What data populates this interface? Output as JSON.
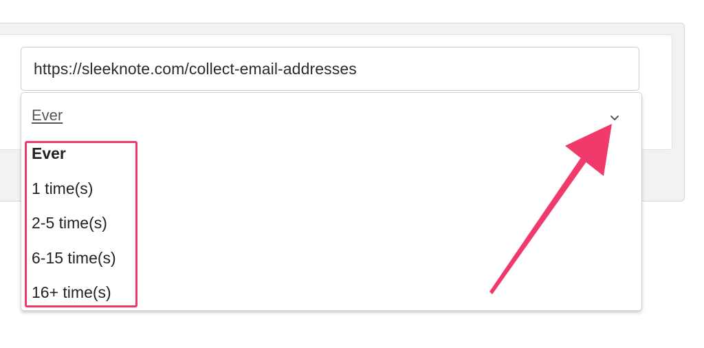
{
  "url_field": {
    "value": "https://sleeknote.com/collect-email-addresses"
  },
  "frequency_dropdown": {
    "selected": "Ever",
    "options": [
      "Ever",
      "1 time(s)",
      "2-5 time(s)",
      "6-15 time(s)",
      "16+ time(s)"
    ],
    "selected_index": 0
  },
  "annotation": {
    "highlight_color": "#f0386b",
    "arrow_icon": "arrow-up-right-icon"
  }
}
